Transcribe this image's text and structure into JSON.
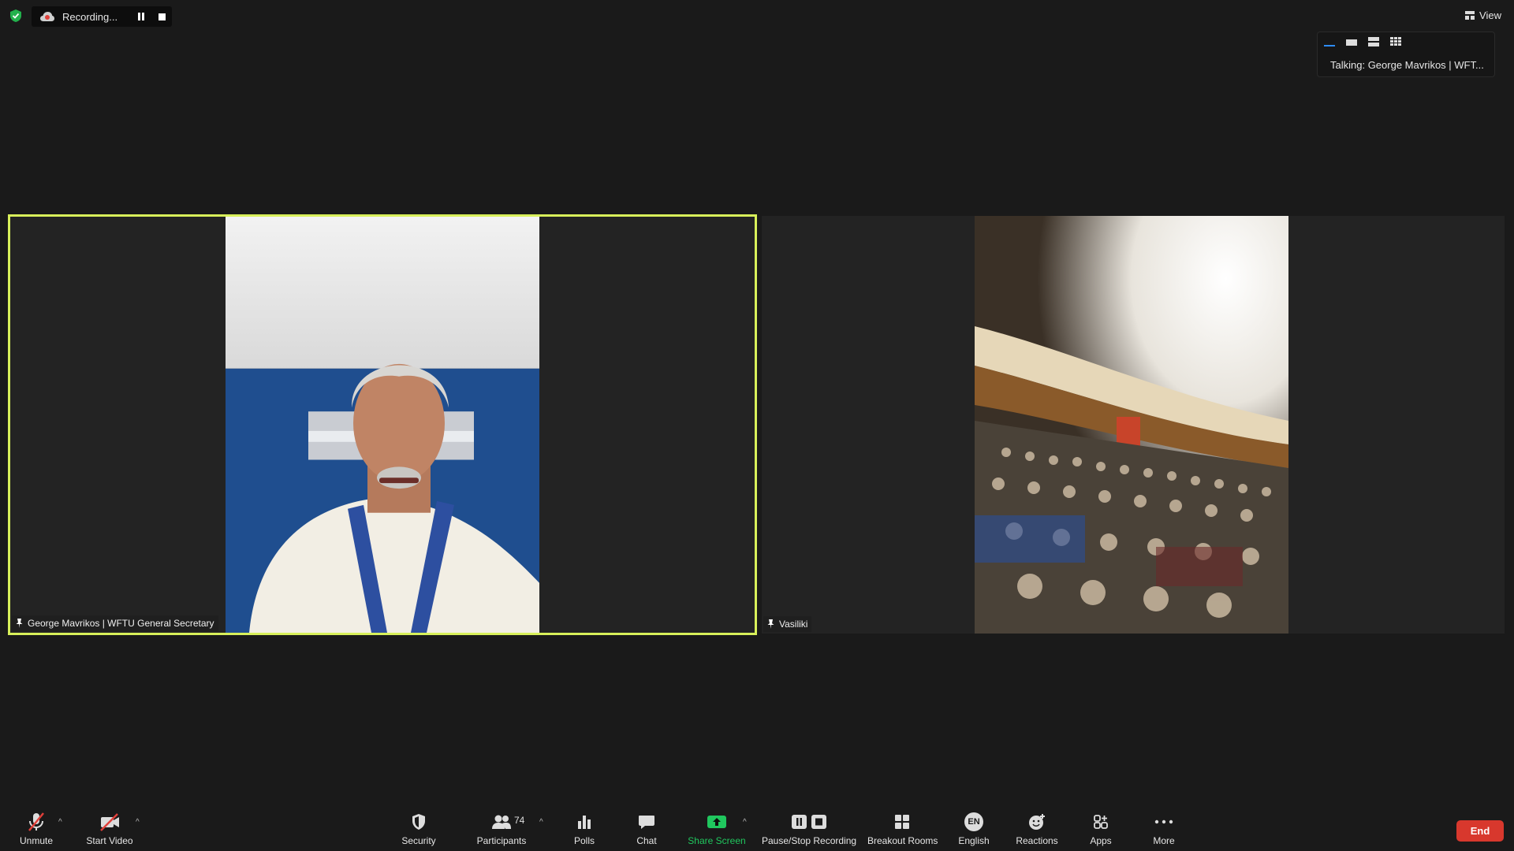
{
  "recording": {
    "label": "Recording..."
  },
  "view": {
    "label": "View"
  },
  "layout_popover": {
    "talking": "Talking: George Mavrikos | WFT..."
  },
  "tiles": [
    {
      "name": "George Mavrikos | WFTU General Secretary"
    },
    {
      "name": "Vasiliki"
    }
  ],
  "toolbar": {
    "unmute": "Unmute",
    "start_video": "Start Video",
    "security": "Security",
    "participants": "Participants",
    "participants_count": "74",
    "polls": "Polls",
    "chat": "Chat",
    "share_screen": "Share Screen",
    "pause_stop_recording": "Pause/Stop Recording",
    "breakout_rooms": "Breakout Rooms",
    "english": "English",
    "english_badge": "EN",
    "reactions": "Reactions",
    "apps": "Apps",
    "more": "More",
    "end": "End"
  },
  "colors": {
    "active_speaker_border": "#d8f05a",
    "share_green": "#20c75e",
    "end_red": "#d8382d",
    "layout_blue": "#2d8cff"
  }
}
